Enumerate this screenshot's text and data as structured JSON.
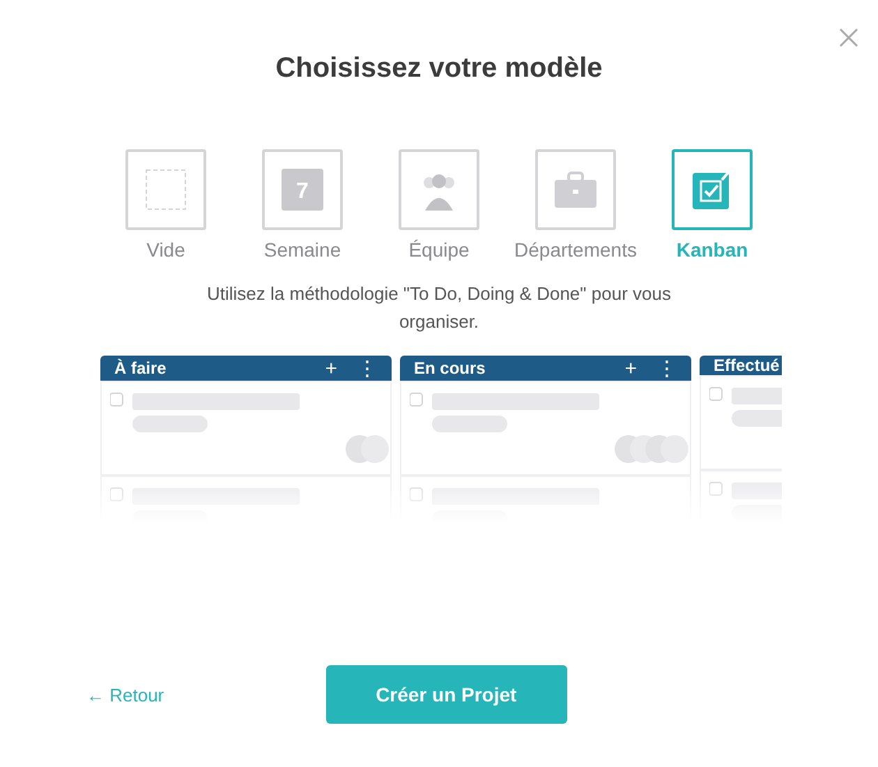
{
  "title": "Choisissez votre modèle",
  "templates": [
    {
      "label": "Vide",
      "kind": "empty",
      "selected": false
    },
    {
      "label": "Semaine",
      "kind": "calendar",
      "icon_text": "7",
      "selected": false
    },
    {
      "label": "Équipe",
      "kind": "team",
      "selected": false
    },
    {
      "label": "Départements",
      "kind": "briefcase",
      "selected": false
    },
    {
      "label": "Kanban",
      "kind": "kanban",
      "selected": true
    }
  ],
  "description": "Utilisez la méthodologie \"To Do, Doing & Done\" pour vous organiser.",
  "columns": [
    {
      "title": "À faire",
      "add": "+",
      "menu": "⋮",
      "kind": "pair"
    },
    {
      "title": "En cours",
      "add": "+",
      "menu": "⋮",
      "kind": "group"
    },
    {
      "title": "Effectué",
      "kind": "plain"
    }
  ],
  "back": "← Retour",
  "create": "Créer un Projet"
}
